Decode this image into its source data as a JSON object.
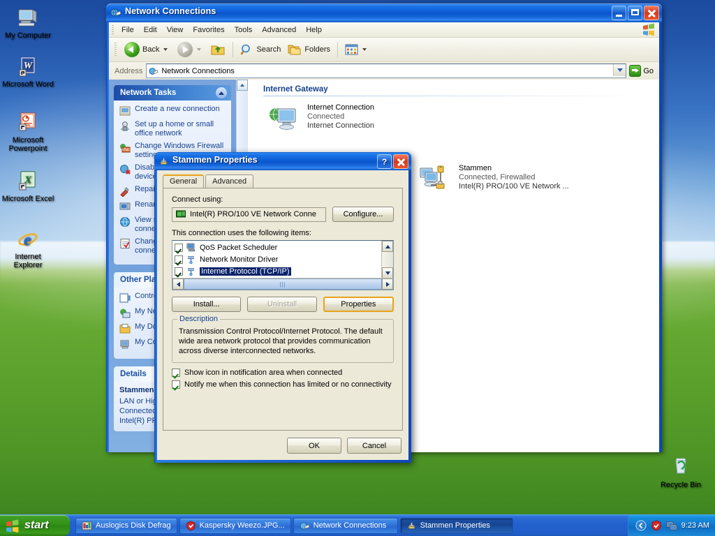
{
  "desktop": {
    "icons": [
      {
        "name": "my-computer",
        "label": "My Computer",
        "icon": "computer-icon"
      },
      {
        "name": "microsoft-word",
        "label": "Microsoft Word",
        "icon": "word-icon"
      },
      {
        "name": "microsoft-powerpoint",
        "label": "Microsoft Powerpoint",
        "icon": "powerpoint-icon"
      },
      {
        "name": "microsoft-excel",
        "label": "Microsoft Excel",
        "icon": "excel-icon"
      },
      {
        "name": "internet-explorer",
        "label": "Internet Explorer",
        "icon": "ie-icon"
      },
      {
        "name": "recycle-bin",
        "label": "Recycle Bin",
        "icon": "recycle-bin-icon"
      }
    ]
  },
  "explorer": {
    "title": "Network Connections",
    "title_icon": "network-connections-icon",
    "window_buttons": {
      "minimize": "minimize-icon",
      "maximize": "maximize-icon",
      "close": "close-icon"
    },
    "menu": [
      "File",
      "Edit",
      "View",
      "Favorites",
      "Tools",
      "Advanced",
      "Help"
    ],
    "toolbar": {
      "back": "Back",
      "forward": "",
      "up": "",
      "search": "Search",
      "folders": "Folders",
      "views": ""
    },
    "address": {
      "label": "Address",
      "value": "Network Connections",
      "go": "Go"
    },
    "sidebar": {
      "panels": [
        {
          "title": "Network Tasks",
          "items": [
            {
              "label": "Create a new connection",
              "icon": "new-connection-icon"
            },
            {
              "label": "Set up a home or small office network",
              "icon": "home-network-icon"
            },
            {
              "label": "Change Windows Firewall settings",
              "icon": "firewall-icon"
            },
            {
              "label": "Disable this network device",
              "icon": "disable-device-icon"
            },
            {
              "label": "Repair this connection",
              "icon": "repair-icon"
            },
            {
              "label": "Rename this connection",
              "icon": "rename-icon"
            },
            {
              "label": "View status of this connection",
              "icon": "view-status-icon"
            },
            {
              "label": "Change settings of this connection",
              "icon": "change-settings-icon"
            }
          ]
        },
        {
          "title": "Other Places",
          "items": [
            {
              "label": "Control Panel",
              "icon": "control-panel-icon"
            },
            {
              "label": "My Network Places",
              "icon": "network-places-icon"
            },
            {
              "label": "My Documents",
              "icon": "documents-icon"
            },
            {
              "label": "My Computer",
              "icon": "computer-icon"
            }
          ]
        },
        {
          "title": "Details",
          "detail_name": "Stammen",
          "detail_lines": [
            "LAN or High-Speed Internet",
            "Connected, Firewalled",
            "Intel(R) PRO/100 VE Net..."
          ]
        }
      ]
    },
    "content": {
      "group_header": "Internet Gateway",
      "gateway": {
        "name": "Internet Connection",
        "status": "Connected",
        "device": "Internet Connection",
        "icon": "internet-gateway-icon"
      },
      "lan": {
        "name": "Stammen",
        "status": "Connected, Firewalled",
        "device": "Intel(R) PRO/100 VE Network ...",
        "icon": "lan-connection-icon"
      }
    }
  },
  "dialog": {
    "title": "Stammen Properties",
    "title_icon": "network-adapter-icon",
    "help_button": "?",
    "close_button": "close-icon",
    "tabs": [
      {
        "label": "General",
        "active": true
      },
      {
        "label": "Advanced",
        "active": false
      }
    ],
    "connect_using_label": "Connect using:",
    "adapter": {
      "name": "Intel(R) PRO/100 VE Network Conne",
      "icon": "nic-icon"
    },
    "configure_button": "Configure...",
    "items_label": "This connection uses the following items:",
    "items": [
      {
        "label": "QoS Packet Scheduler",
        "checked": true,
        "selected": false,
        "icon": "qos-icon"
      },
      {
        "label": "Network Monitor Driver",
        "checked": true,
        "selected": false,
        "icon": "protocol-icon"
      },
      {
        "label": "Internet Protocol (TCP/IP)",
        "checked": true,
        "selected": true,
        "icon": "protocol-icon"
      }
    ],
    "buttons": {
      "install": "Install...",
      "uninstall": "Uninstall",
      "properties": "Properties"
    },
    "description": {
      "title": "Description",
      "text": "Transmission Control Protocol/Internet Protocol. The default wide area network protocol that provides communication across diverse interconnected networks."
    },
    "checkboxes": [
      {
        "label": "Show icon in notification area when connected",
        "checked": true
      },
      {
        "label": "Notify me when this connection has limited or no connectivity",
        "checked": true
      }
    ],
    "footer": {
      "ok": "OK",
      "cancel": "Cancel"
    }
  },
  "taskbar": {
    "start": "start",
    "start_icon": "windows-flag-icon",
    "buttons": [
      {
        "label": "Auslogics Disk Defrag",
        "icon": "defrag-icon",
        "active": false
      },
      {
        "label": "Kaspersky Weezo.JPG...",
        "icon": "kaspersky-icon",
        "active": false
      },
      {
        "label": "Network Connections",
        "icon": "network-connections-icon",
        "active": false
      },
      {
        "label": "Stammen Properties",
        "icon": "network-adapter-icon",
        "active": true
      }
    ],
    "tray": {
      "icons": [
        "show-hidden-icons-icon",
        "kaspersky-tray-icon",
        "network-tray-icon"
      ],
      "clock": "9:23 AM"
    }
  },
  "colors": {
    "title_blue": "#0a5fd4",
    "accent_orange": "#e8a31b",
    "selection_blue": "#0a246a",
    "taskbar_blue": "#2361cd",
    "start_green": "#329117"
  }
}
